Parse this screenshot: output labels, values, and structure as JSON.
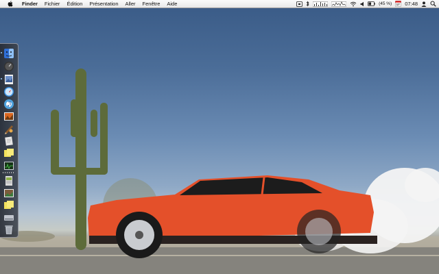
{
  "menubar": {
    "app_name": "Finder",
    "menus": [
      "Fichier",
      "Édition",
      "Présentation",
      "Aller",
      "Fenêtre",
      "Aide"
    ],
    "battery_text": "(45 %)",
    "calendar_day": "17",
    "clock": "07:48"
  },
  "dock": {
    "items": [
      {
        "name": "finder-icon",
        "color": "#2f6fd6"
      },
      {
        "name": "dashboard-icon",
        "color": "#333333"
      },
      {
        "name": "preview-icon",
        "color": "#6c8fc8"
      },
      {
        "name": "safari-icon",
        "color": "#3b8fe0"
      },
      {
        "name": "itunes-icon",
        "color": "#4ea2de"
      },
      {
        "name": "iphoto-icon",
        "color": "#d9661f"
      },
      {
        "name": "script-editor-icon",
        "color": "#8b5a2b"
      },
      {
        "name": "textedit-icon",
        "color": "#e6e6e6"
      },
      {
        "name": "stickies-icon",
        "color": "#f2e15c"
      },
      {
        "name": "activity-monitor-icon",
        "color": "#2e5e2e"
      },
      {
        "name": "document-icon",
        "color": "#d9d9d9"
      },
      {
        "name": "photo-icon",
        "color": "#7a5c3c"
      },
      {
        "name": "stickies-2-icon",
        "color": "#f2e15c"
      },
      {
        "name": "drive-icon",
        "color": "#c0c4cc"
      },
      {
        "name": "trash-icon",
        "color": "#b9bec6"
      }
    ]
  },
  "wallpaper": {
    "car_color": "#e4502a",
    "sky_color": "#4b6d98"
  }
}
